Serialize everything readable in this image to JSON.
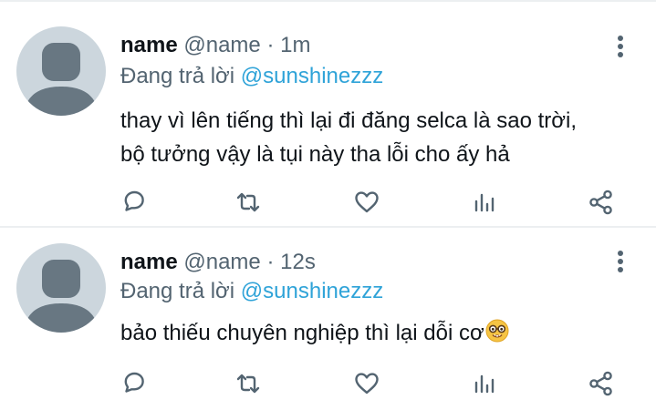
{
  "tweets": [
    {
      "display_name": "name",
      "handle": "@name",
      "separator": "·",
      "time": "1m",
      "reply_prefix": "Đang trả lời",
      "reply_to": "@sunshinezzz",
      "text_lines": [
        "thay vì lên tiếng thì lại đi đăng selca là sao trời,",
        "bộ tưởng vậy là tụi này tha lỗi cho ấy hả"
      ]
    },
    {
      "display_name": "name",
      "handle": "@name",
      "separator": "·",
      "time": "12s",
      "reply_prefix": "Đang trả lời",
      "reply_to": "@sunshinezzz",
      "text_lines": [
        "bảo thiếu chuyên nghiệp thì lại dỗi cơ"
      ],
      "emoji": "nerd-face-emoji"
    }
  ],
  "icons": {
    "avatar": "default-avatar-icon",
    "more": "more-vertical-icon",
    "reply": "reply-icon",
    "retweet": "retweet-icon",
    "like": "heart-icon",
    "views": "views-icon",
    "share": "share-icon"
  },
  "colors": {
    "text": "#0f1419",
    "secondary": "#536471",
    "mention": "#2fa3d8",
    "avatar_bg": "#ccd6dd",
    "avatar_fg": "#687782",
    "divider": "#eceff1"
  }
}
